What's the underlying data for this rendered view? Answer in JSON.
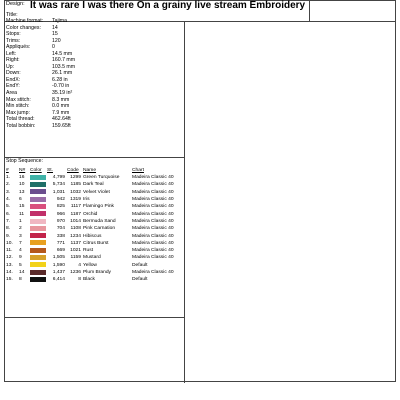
{
  "header": {
    "design_label": "Design:",
    "design_name": "It was rare I was there On a grainy live stream Embroidery",
    "title_label": "Title:"
  },
  "info": [
    {
      "key": "Machine format:",
      "value": "Tajima"
    },
    {
      "key": "Color changes:",
      "value": "14"
    },
    {
      "key": "Stops:",
      "value": "15"
    },
    {
      "key": "Trims:",
      "value": "120"
    },
    {
      "key": "Appliqués:",
      "value": "0"
    },
    {
      "key": "Left:",
      "value": "14.5 mm"
    },
    {
      "key": "Right:",
      "value": "160.7 mm"
    },
    {
      "key": "Up:",
      "value": "103.5 mm"
    },
    {
      "key": "Down:",
      "value": "26.1 mm"
    },
    {
      "key": "EndX:",
      "value": "6.28 in"
    },
    {
      "key": "EndY:",
      "value": "-0.70 in"
    },
    {
      "key": "Area",
      "value": "35.19 in²"
    },
    {
      "key": "Max stitch:",
      "value": "8.3 mm"
    },
    {
      "key": "Min stitch:",
      "value": "0.0 mm"
    },
    {
      "key": "Max jump:",
      "value": "7.9 mm"
    },
    {
      "key": "Total thread:",
      "value": "462.64ft"
    },
    {
      "key": "Total bobbin:",
      "value": "159.65ft"
    }
  ],
  "sequence": {
    "label": "Stop Sequence:",
    "headers": {
      "idx": "#",
      "n": "N#",
      "color": "Color",
      "st": "St.",
      "code": "Code",
      "name": "Name",
      "chart": "Chart"
    },
    "stops": [
      {
        "idx": "1.",
        "n": "16",
        "color": "#3fb3a8",
        "st": "4,799",
        "code": "1299",
        "name": "Green Turquoise",
        "chart": "Madeira Classic 40"
      },
      {
        "idx": "2.",
        "n": "10",
        "color": "#1f6f68",
        "st": "5,734",
        "code": "1185",
        "name": "Dark Teal",
        "chart": "Madeira Classic 40"
      },
      {
        "idx": "3.",
        "n": "13",
        "color": "#6b4e8e",
        "st": "1,031",
        "code": "1032",
        "name": "Velvet Violet",
        "chart": "Madeira Classic 40"
      },
      {
        "idx": "4.",
        "n": "6",
        "color": "#9a6da8",
        "st": "942",
        "code": "1319",
        "name": "Iris",
        "chart": "Madeira Classic 40"
      },
      {
        "idx": "5.",
        "n": "15",
        "color": "#d94f7e",
        "st": "825",
        "code": "1117",
        "name": "Flamingo Pink",
        "chart": "Madeira Classic 40"
      },
      {
        "idx": "6.",
        "n": "11",
        "color": "#c1306a",
        "st": "966",
        "code": "1187",
        "name": "Orchid",
        "chart": "Madeira Classic 40"
      },
      {
        "idx": "7.",
        "n": "1",
        "color": "#f0b7c2",
        "st": "970",
        "code": "1014",
        "name": "Bermuda Sand",
        "chart": "Madeira Classic 40"
      },
      {
        "idx": "8.",
        "n": "2",
        "color": "#e8969e",
        "st": "704",
        "code": "1108",
        "name": "Pink Carnation",
        "chart": "Madeira Classic 40"
      },
      {
        "idx": "9.",
        "n": "3",
        "color": "#c2244a",
        "st": "338",
        "code": "1234",
        "name": "Hibiscus",
        "chart": "Madeira Classic 40"
      },
      {
        "idx": "10.",
        "n": "7",
        "color": "#e8a020",
        "st": "771",
        "code": "1137",
        "name": "Citrus Burst",
        "chart": "Madeira Classic 40"
      },
      {
        "idx": "11.",
        "n": "4",
        "color": "#b4581c",
        "st": "669",
        "code": "1021",
        "name": "Rust",
        "chart": "Madeira Classic 40"
      },
      {
        "idx": "12.",
        "n": "9",
        "color": "#d6a12a",
        "st": "1,505",
        "code": "1159",
        "name": "Mustard",
        "chart": "Madeira Classic 40"
      },
      {
        "idx": "13.",
        "n": "5",
        "color": "#f2d21a",
        "st": "1,590",
        "code": "4",
        "name": "Yellow",
        "chart": "Default"
      },
      {
        "idx": "14.",
        "n": "14",
        "color": "#5a2a2a",
        "st": "1,437",
        "code": "1236",
        "name": "Plum Brandy",
        "chart": "Madeira Classic 40"
      },
      {
        "idx": "15.",
        "n": "8",
        "color": "#111111",
        "st": "6,414",
        "code": "8",
        "name": "Black",
        "chart": "Default"
      }
    ]
  }
}
